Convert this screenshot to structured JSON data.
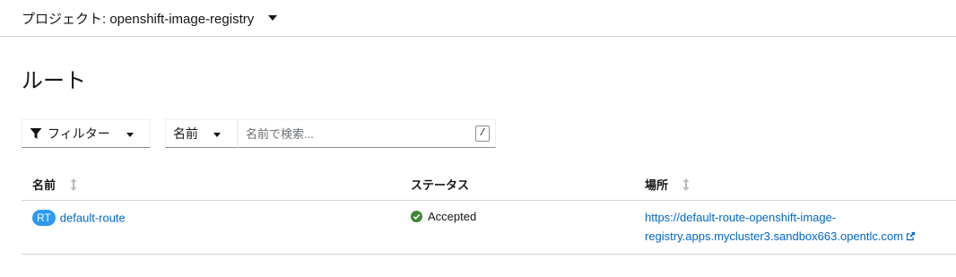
{
  "project": {
    "label": "プロジェクト: openshift-image-registry"
  },
  "page": {
    "title": "ルート"
  },
  "toolbar": {
    "filter_label": "フィルター",
    "name_dropdown_label": "名前",
    "search_placeholder": "名前で検索...",
    "search_value": "",
    "shortcut_key": "/"
  },
  "table": {
    "columns": [
      {
        "label": "名前",
        "sortable": true
      },
      {
        "label": "ステータス",
        "sortable": false
      },
      {
        "label": "場所",
        "sortable": true
      }
    ],
    "rows": [
      {
        "badge": "RT",
        "name": "default-route",
        "status": "Accepted",
        "location_line1": "https://default-route-openshift-image-",
        "location_line2": "registry.apps.mycluster3.sandbox663.opentlc.com"
      }
    ]
  },
  "colors": {
    "link": "#0066cc",
    "badge_bg": "#2b9af3",
    "success": "#3e8635",
    "border": "#d2d2d2"
  },
  "icons": {
    "project_caret": "caret-down-icon",
    "filter": "filter-icon",
    "sort": "sort-icon",
    "status": "check-circle-icon",
    "external": "external-link-icon"
  }
}
